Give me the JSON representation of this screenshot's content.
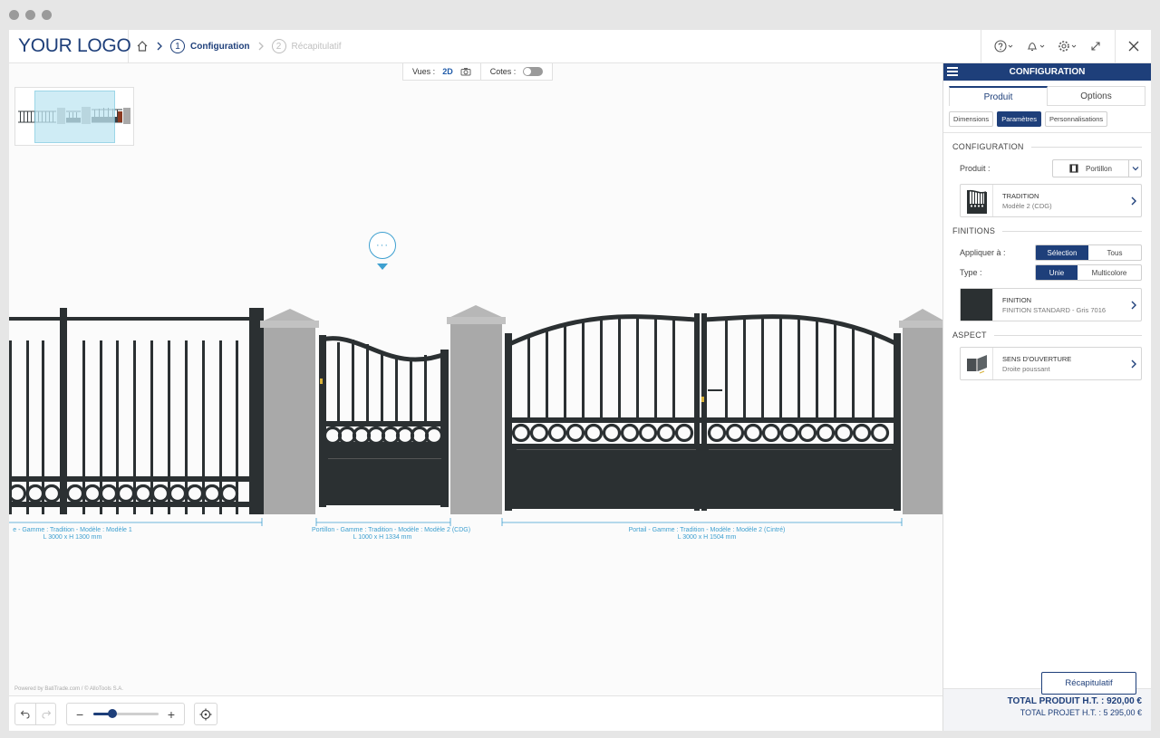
{
  "header": {
    "logo_text": "YOUR LOGO",
    "steps": [
      {
        "num": "1",
        "label": "Configuration",
        "active": true
      },
      {
        "num": "2",
        "label": "Récapitulatif",
        "active": false
      }
    ],
    "icons": [
      "help-icon",
      "bell-icon",
      "gear-icon",
      "fullscreen-icon",
      "close-icon"
    ]
  },
  "viewbar": {
    "views_label": "Vues :",
    "view_mode": "2D",
    "dims_label": "Cotes :",
    "dims_enabled": false
  },
  "canvas": {
    "action_label": "···",
    "powered_by": "Powered by BatiTrade.com / © AlloTools S.A.",
    "dimensions": [
      {
        "line1": "e - Gamme : Tradition - Modèle : Modèle 1",
        "line2": "L 3000 x H 1300 mm"
      },
      {
        "line1": "Portillon - Gamme : Tradition - Modèle : Modèle 2 (CDG)",
        "line2": "L 1000 x H 1334 mm"
      },
      {
        "line1": "Portail - Gamme : Tradition - Modèle : Modèle 2 (Cintré)",
        "line2": "L 3000 x H 1504 mm"
      }
    ],
    "colors": {
      "metal": "#2b3032",
      "pillar": "#a9a9a9",
      "accent": "#3ea0d0"
    }
  },
  "bottombar": {
    "zoom_level": 0.3,
    "recap_label": "Récapitulatif"
  },
  "panel": {
    "title": "CONFIGURATION",
    "tabs": [
      "Produit",
      "Options"
    ],
    "subtabs": [
      "Dimensions",
      "Paramètres",
      "Personnalisations"
    ],
    "config_title": "CONFIGURATION",
    "product_label": "Produit :",
    "product_value": "Portillon",
    "model_title": "TRADITION",
    "model_sub": "Modèle 2 (CDG)",
    "finitions_title": "FINITIONS",
    "apply_label": "Appliquer à :",
    "apply_options": [
      "Sélection",
      "Tous"
    ],
    "type_label": "Type :",
    "type_options": [
      "Unie",
      "Multicolore"
    ],
    "finish_title": "FINITION",
    "finish_sub": "FINITION STANDARD - Gris 7016",
    "finish_color": "#2b3032",
    "aspect_title": "ASPECT",
    "opening_title": "SENS D'OUVERTURE",
    "opening_sub": "Droite poussant",
    "total_product": "TOTAL PRODUIT H.T. : 920,00 €",
    "total_project": "TOTAL PROJET H.T. : 5 295,00 €"
  }
}
